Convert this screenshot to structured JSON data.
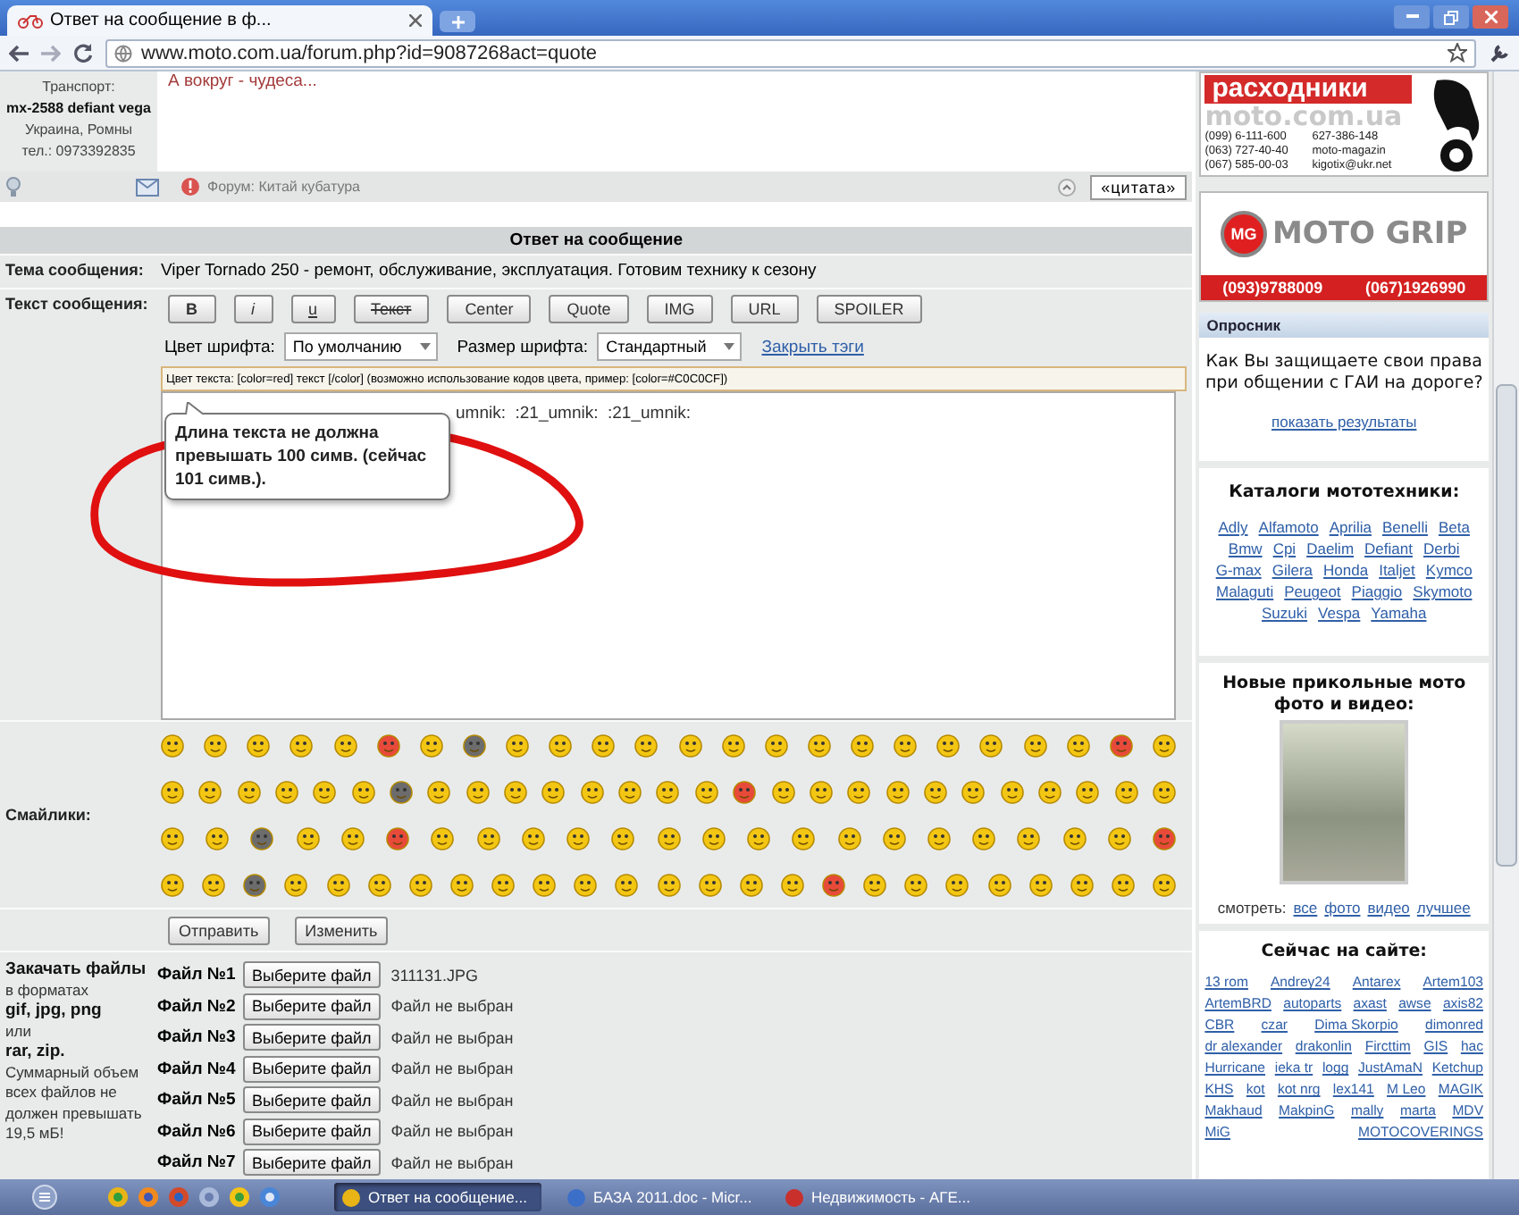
{
  "browser": {
    "tab_title": "Ответ на сообщение в ф...",
    "url": "www.moto.com.ua/forum.php?id=9087268act=quote"
  },
  "post": {
    "author_info": [
      {
        "text": "Транспорт:",
        "bold": false
      },
      {
        "text": "mx-2588 defiant vega",
        "bold": true
      },
      {
        "text": "Украина, Ромны",
        "bold": false
      },
      {
        "text": "тел.: 0973392835",
        "bold": false
      }
    ],
    "body": "А вокруг - чудеса...",
    "forum": "Форум: Китай кубатура",
    "quote_button": "«цитата»"
  },
  "reply_form": {
    "title": "Ответ на сообщение",
    "subject_label": "Тема сообщения:",
    "subject": "Viper Tornado 250 - ремонт, обслуживание, эксплуатация. Готовим технику к сезону",
    "text_label": "Текст сообщения:",
    "format_buttons": [
      {
        "label": "B",
        "kind": "bold"
      },
      {
        "label": "i",
        "kind": "italic"
      },
      {
        "label": "u",
        "kind": "underline"
      },
      {
        "label": "Текст",
        "kind": "strike"
      },
      {
        "label": "Center",
        "kind": "plain"
      },
      {
        "label": "Quote",
        "kind": "plain"
      },
      {
        "label": "IMG",
        "kind": "plain"
      },
      {
        "label": "URL",
        "kind": "plain"
      },
      {
        "label": "SPOILER",
        "kind": "plain"
      }
    ],
    "font_color": {
      "label": "Цвет шрифта:",
      "value": "По умолчанию"
    },
    "font_size": {
      "label": "Размер шрифта:",
      "value": "Стандартный"
    },
    "close_tags": "Закрыть тэги",
    "hint": "Цвет текста: [color=red] текст [/color] (возможно использование кодов цвета, пример: [color=#C0C0CF])",
    "message": "umnik:  :21_umnik:  :21_umnik:",
    "tooltip": "Длина текста не должна превышать 100 симв. (сейчас 101 симв.).",
    "smileys_label": "Смайлики:",
    "submit_buttons": [
      "Отправить",
      "Изменить"
    ],
    "upload_info": [
      {
        "text": "Закачать файлы",
        "bold": true
      },
      {
        "text": "в форматах",
        "bold": false
      },
      {
        "text": "gif, jpg, png",
        "bold": true
      },
      {
        "text": "или",
        "bold": false
      },
      {
        "text": "rar, zip.",
        "bold": true
      },
      {
        "text": "Суммарный объем всех файлов не должен превышать 19,5 мБ!",
        "bold": false
      }
    ],
    "files": [
      {
        "label": "Файл №1",
        "button": "Выберите файл",
        "status": "311131.JPG"
      },
      {
        "label": "Файл №2",
        "button": "Выберите файл",
        "status": "Файл не выбран"
      },
      {
        "label": "Файл №3",
        "button": "Выберите файл",
        "status": "Файл не выбран"
      },
      {
        "label": "Файл №4",
        "button": "Выберите файл",
        "status": "Файл не выбран"
      },
      {
        "label": "Файл №5",
        "button": "Выберите файл",
        "status": "Файл не выбран"
      },
      {
        "label": "Файл №6",
        "button": "Выберите файл",
        "status": "Файл не выбран"
      },
      {
        "label": "Файл №7",
        "button": "Выберите файл",
        "status": "Файл не выбран"
      }
    ]
  },
  "sidebar": {
    "ad": {
      "title": "расходники",
      "site": "moto.com.ua",
      "contacts": [
        "(099) 6-111-600",
        "627-386-148",
        "(063) 727-40-40",
        "moto-magazin",
        "(067) 585-00-03",
        "kigotix@ukr.net"
      ]
    },
    "grip": {
      "badge": "MG",
      "logo": "MOTO GRIP",
      "phones": [
        "(093)9788009",
        "(067)1926990"
      ]
    },
    "poll": {
      "header": "Опросник",
      "question": "Как Вы защищаете свои права при общении с ГАИ на дороге?",
      "link": "показать результаты"
    },
    "catalogs": {
      "title": "Каталоги мототехники:",
      "brands": [
        "Adly",
        "Alfamoto",
        "Aprilia",
        "Benelli",
        "Beta",
        "Bmw",
        "Cpi",
        "Daelim",
        "Defiant",
        "Derbi",
        "G-max",
        "Gilera",
        "Honda",
        "Italjet",
        "Kymco",
        "Malaguti",
        "Peugeot",
        "Piaggio",
        "Skymoto",
        "Suzuki",
        "Vespa",
        "Yamaha"
      ]
    },
    "media": {
      "title": "Новые прикольные мото фото и видео:",
      "view_label": "смотреть:",
      "links": [
        "все",
        "фото",
        "видео",
        "лучшее"
      ]
    },
    "online": {
      "title": "Сейчас на сайте:",
      "users": [
        "13 rom",
        "Andrey24",
        "Antarex",
        "Artem103",
        "ArtemBRD",
        "autoparts",
        "axast",
        "awse",
        "axis82",
        "CBR",
        "czar",
        "Dima Skorpio",
        "dimonred",
        "dr alexander",
        "drakonlin",
        "Fircttim",
        "GIS",
        "hac",
        "Hurricane",
        "ieka tr",
        "logg",
        "JustAmaN",
        "Ketchup",
        "KHS",
        "kot",
        "kot nrg",
        "lex141",
        "M Leo",
        "MAGIK",
        "Makhaud",
        "MakpinG",
        "mally",
        "marta",
        "MDV",
        "MiG",
        "MOTOCOVERINGS"
      ]
    }
  },
  "taskbar": {
    "tasks": [
      {
        "label": "Ответ на сообщение...",
        "selected": true
      },
      {
        "label": "БАЗА 2011.doc - Micr...",
        "selected": false
      },
      {
        "label": "Недвижимость - АГЕ...",
        "selected": false
      }
    ]
  }
}
